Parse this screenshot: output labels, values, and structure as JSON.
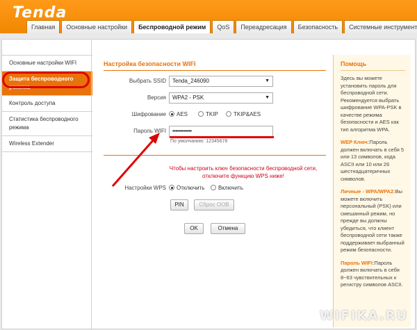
{
  "header": {
    "logo": "Tenda",
    "tabs": [
      {
        "label": "Главная"
      },
      {
        "label": "Основные настройки"
      },
      {
        "label": "Беспроводной режим"
      },
      {
        "label": "QoS"
      },
      {
        "label": "Переадресация"
      },
      {
        "label": "Безопасность"
      },
      {
        "label": "Системные инструменты"
      }
    ],
    "active_tab": "Беспроводной режим"
  },
  "sidebar": {
    "items": [
      {
        "label": "Основные настройки WIFI"
      },
      {
        "label": "Защита беспроводного режима"
      },
      {
        "label": "Контроль доступа"
      },
      {
        "label": "Статистика беспроводного режима"
      },
      {
        "label": "Wireless Extender"
      }
    ],
    "active_index": 1
  },
  "content": {
    "title": "Настройка безопасности WIFI",
    "ssid_label": "Выбрать SSID",
    "ssid_value": "Tenda_246090",
    "version_label": "Версия",
    "version_value": "WPA2 - PSK",
    "encryption_label": "Шифрование",
    "encryption_options": [
      "AES",
      "TKIP",
      "TKIP&AES"
    ],
    "encryption_selected": "AES",
    "password_label": "Пароль WIFI",
    "password_value": "••••••••••••",
    "password_hint": "По умолчанию: 12345678",
    "wps_warning": "Чтобы настроить ключ безопасности беспроводной сети, отключите функцию WPS ниже!",
    "wps_label": "Настройки WPS",
    "wps_options": [
      "Отключить",
      "Включить"
    ],
    "wps_selected": "Отключить",
    "pin_button": "PIN",
    "reset_oob_button": "Сброс OOB",
    "ok_button": "OK",
    "cancel_button": "Отмена"
  },
  "help": {
    "title": "Помощь",
    "intro": "Здесь вы можете установить пароль для беспроводной сети. Рекомендуется выбрать шифрование WPA-PSK в качестве режима безопасности и AES как тип алгоритма WPA.",
    "wep_key": "WEP Ключ:",
    "wep_text": "Пароль должен включать в себя 5 или 13 символов, кода ASCII или 10 или 26 шестнадцатеричных символов.",
    "personal_key": "Личные - WPA/WPA2:",
    "personal_text": "Вы можете включить персональный (PSK) или смешанный режим, но прежде вы должны убедиться, что клиент беспроводной сети также поддерживает выбранный режим безопасности.",
    "wifi_pwd_key": "Пароль WIFI:",
    "wifi_pwd_text": "Пароль должен включать в себя 8~63 чувствительных к регистру символов ASCII."
  },
  "watermark": "WIFIKA.RU",
  "colors": {
    "accent": "#e8730a",
    "highlight": "#e00000",
    "warning_text": "#d0021b"
  }
}
